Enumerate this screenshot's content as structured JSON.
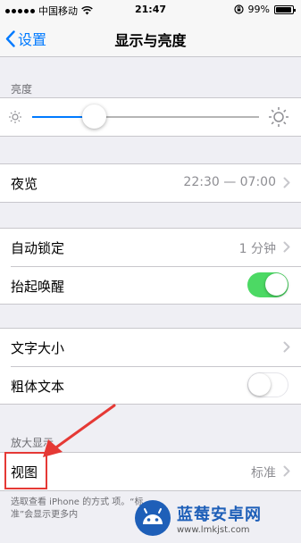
{
  "status_bar": {
    "carrier": "中国移动",
    "time": "21:47",
    "battery_text": "99%",
    "battery_level": 0.99,
    "icons": [
      "signal-dots-icon",
      "wifi-icon",
      "rotation-lock-icon",
      "battery-icon"
    ]
  },
  "nav": {
    "back_label": "设置",
    "title": "显示与亮度"
  },
  "brightness": {
    "header": "亮度",
    "level": 0.27,
    "accent": "#007aff"
  },
  "night_shift": {
    "label": "夜览",
    "value": "22:30 — 07:00"
  },
  "auto_lock": {
    "label": "自动锁定",
    "value": "1 分钟"
  },
  "raise_to_wake": {
    "label": "抬起唤醒",
    "on": true
  },
  "text_size": {
    "label": "文字大小"
  },
  "bold_text": {
    "label": "粗体文本",
    "on": false
  },
  "zoom": {
    "header": "放大显示",
    "view_label": "视图",
    "view_value": "标准",
    "footer": "选取查看 iPhone 的方式 项。“标准”会显示更多内"
  },
  "watermark": {
    "name": "蓝莓安卓网",
    "url": "www.lmkjst.com"
  },
  "colors": {
    "toggle_on": "#4cd964",
    "annotation_red": "#e53935",
    "link_blue": "#007aff"
  }
}
